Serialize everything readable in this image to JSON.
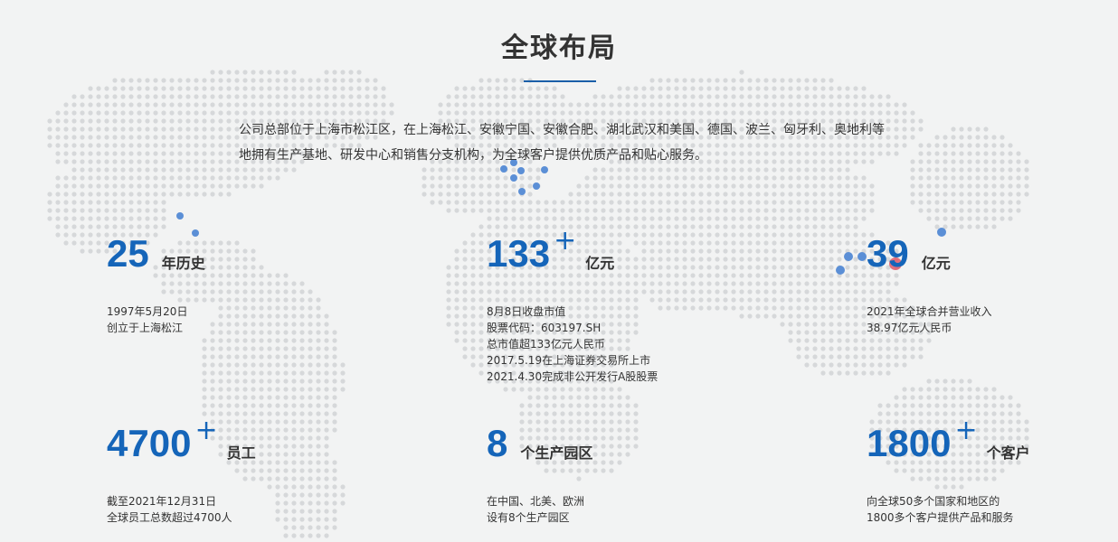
{
  "title": "全球布局",
  "intro": "公司总部位于上海市松江区，在上海松江、安徽宁国、安徽合肥、湖北武汉和美国、德国、波兰、匈牙利、奥地利等地拥有生产基地、研发中心和销售分支机构，为全球客户提供优质产品和贴心服务。",
  "stats": [
    {
      "number": "25",
      "plus": "",
      "unit": "年历史",
      "desc": [
        "1997年5月20日",
        "创立于上海松江"
      ]
    },
    {
      "number": "133",
      "plus": "+",
      "unit": "亿元",
      "desc": [
        "8月8日收盘市值",
        "股票代码：603197.SH",
        "总市值超133亿元人民币",
        "2017.5.19在上海证券交易所上市",
        "2021.4.30完成非公开发行A股股票"
      ]
    },
    {
      "number": "39",
      "plus": "",
      "unit": "亿元",
      "desc": [
        "2021年全球合并营业收入",
        "38.97亿元人民币"
      ]
    },
    {
      "number": "4700",
      "plus": "+",
      "unit": "员工",
      "desc": [
        "截至2021年12月31日",
        "全球员工总数超过4700人"
      ]
    },
    {
      "number": "8",
      "plus": "",
      "unit": "个生产园区",
      "desc": [
        "在中国、北美、欧洲",
        "设有8个生产园区"
      ]
    },
    {
      "number": "1800",
      "plus": "+",
      "unit": "个客户",
      "desc": [
        "向全球50多个国家和地区的",
        "1800多个客户提供产品和服务"
      ]
    }
  ],
  "colors": {
    "accent": "#1565b9",
    "marker_blue": "#5b8fd6",
    "marker_headquarters": "#e05a68",
    "map_dot": "#d6d8da",
    "background": "#f2f3f3"
  }
}
